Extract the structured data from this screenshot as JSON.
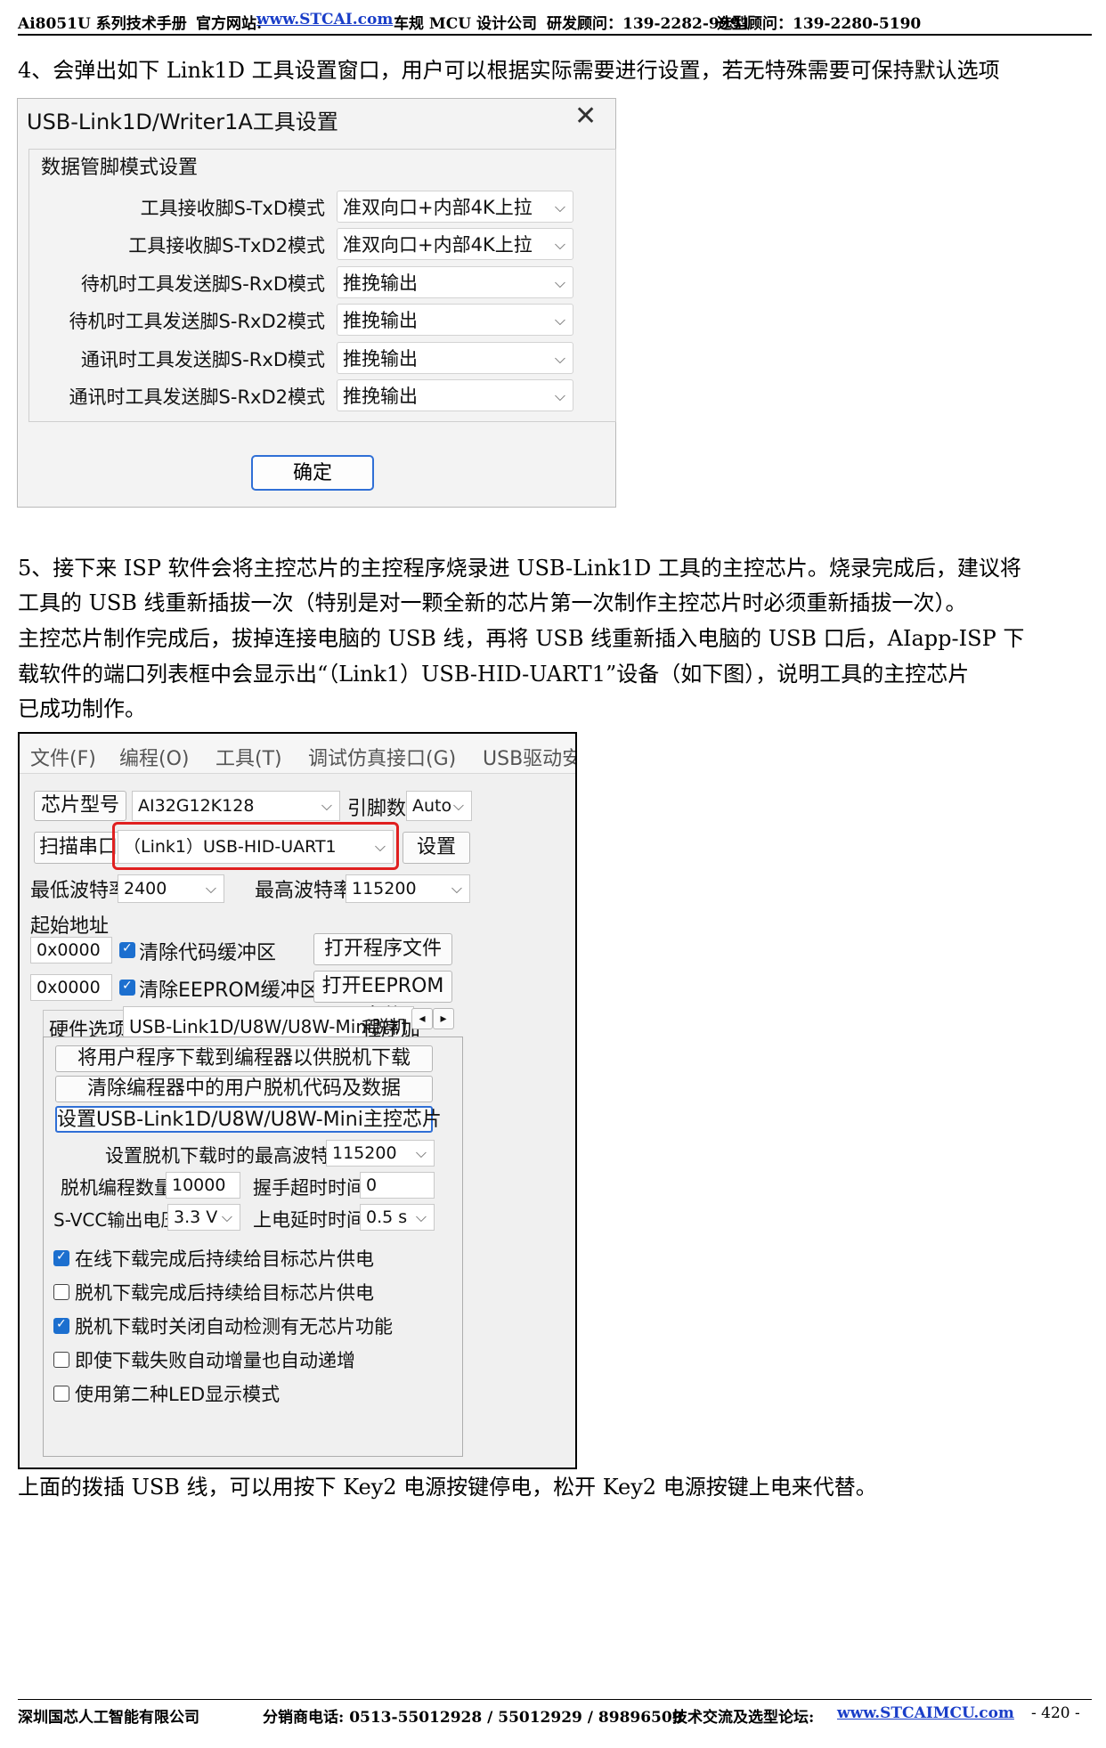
{
  "header": {
    "manual": "Ai8051U 系列技术手册",
    "site_label": "官方网站:",
    "site_url": "www.STCAI.com",
    "company": "车规 MCU 设计公司",
    "dev_advisor": "研发顾问：139-2282-9991",
    "sel_advisor": "选型顾问：139-2280-5190"
  },
  "step4": "4、会弹出如下 Link1D 工具设置窗口，用户可以根据实际需要进行设置，若无特殊需要可保持默认选项",
  "dialog1": {
    "title": "USB-Link1D/Writer1A工具设置",
    "close": "✕",
    "group_label": "数据管脚模式设置",
    "rows": [
      {
        "label": "工具接收脚S-TxD模式",
        "value": "准双向口+内部4K上拉"
      },
      {
        "label": "工具接收脚S-TxD2模式",
        "value": "准双向口+内部4K上拉"
      },
      {
        "label": "待机时工具发送脚S-RxD模式",
        "value": "推挽输出"
      },
      {
        "label": "待机时工具发送脚S-RxD2模式",
        "value": "推挽输出"
      },
      {
        "label": "通讯时工具发送脚S-RxD模式",
        "value": "推挽输出"
      },
      {
        "label": "通讯时工具发送脚S-RxD2模式",
        "value": "推挽输出"
      }
    ],
    "ok": "确定"
  },
  "step5": [
    "5、接下来 ISP 软件会将主控芯片的主控程序烧录进 USB-Link1D 工具的主控芯片。烧录完成后，建议将",
    "工具的 USB 线重新插拔一次（特别是对一颗全新的芯片第一次制作主控芯片时必须重新插拔一次）。",
    "主控芯片制作完成后，拔掉连接电脑的 USB 线，再将 USB 线重新插入电脑的 USB 口后，AIapp-ISP 下",
    "载软件的端口列表框中会显示出“（Link1）USB-HID-UART1”设备（如下图），说明工具的主控芯片",
    "已成功制作。"
  ],
  "isp": {
    "menu": [
      "文件(F)",
      "编程(O)",
      "工具(T)",
      "调试仿真接口(G)",
      "USB驱动安"
    ],
    "chip_btn": "芯片型号",
    "chip_value": "AI32G12K128",
    "pin_label": "引脚数",
    "pin_value": "Auto",
    "scan_btn": "扫描串口",
    "port_value": "（Link1）USB-HID-UART1",
    "settings_btn": "设置",
    "min_baud_label": "最低波特率",
    "min_baud": "2400",
    "max_baud_label": "最高波特率",
    "max_baud": "115200",
    "start_addr_label": "起始地址",
    "addr1": "0x0000",
    "clear_code": "清除代码缓冲区",
    "open_prog": "打开程序文件",
    "addr2": "0x0000",
    "clear_eeprom": "清除EEPROM缓冲区",
    "open_eeprom": "打开EEPROM文件",
    "tabs": [
      "硬件选项",
      "USB-Link1D/U8W/U8W-Mini脱机",
      "程序加"
    ],
    "tab_prev": "◂",
    "tab_next": "▸",
    "panel_buttons": [
      "将用户程序下载到编程器以供脱机下载",
      "清除编程器中的用户脱机代码及数据",
      "设置USB-Link1D/U8W/U8W-Mini主控芯片"
    ],
    "offline_max_baud_label": "设置脱机下载时的最高波特率",
    "offline_max_baud": "115200",
    "count_label": "脱机编程数量",
    "count": "10000",
    "handshake_label": "握手超时时间",
    "handshake": "0",
    "vcc_label": "S-VCC输出电压",
    "vcc": "3.3 V",
    "delay_label": "上电延时时间",
    "delay": "0.5 s",
    "checks": [
      {
        "label": "在线下载完成后持续给目标芯片供电",
        "checked": true
      },
      {
        "label": "脱机下载完成后持续给目标芯片供电",
        "checked": false
      },
      {
        "label": "脱机下载时关闭自动检测有无芯片功能",
        "checked": true
      },
      {
        "label": "即使下载失败自动增量也自动递增",
        "checked": false
      },
      {
        "label": "使用第二种LED显示模式",
        "checked": false
      }
    ]
  },
  "note": "上面的拨插 USB 线，可以用按下 Key2 电源按键停电，松开 Key2 电源按键上电来代替。",
  "footer": {
    "company": "深圳国芯人工智能有限公司",
    "phone": "分销商电话: 0513-55012928 / 55012929 / 89896509",
    "forum_label": "技术交流及选型论坛:",
    "forum_url": "www.STCAIMCU.com",
    "page": "- 420 -"
  },
  "colors": {
    "highlight": "#e02020",
    "accent": "#1c6fcf",
    "link": "#1a3ec8"
  }
}
